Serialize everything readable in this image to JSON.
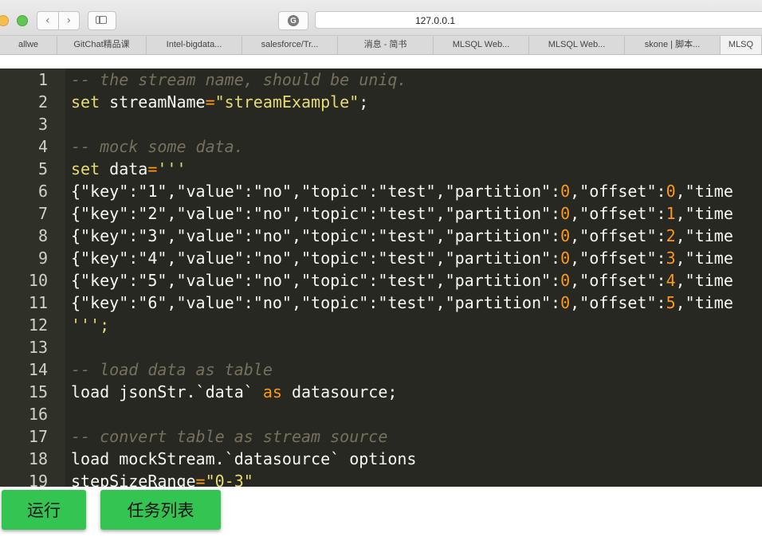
{
  "browser": {
    "url": "127.0.0.1",
    "reload_icon": "G",
    "back_icon": "‹",
    "forward_icon": "›",
    "tabs": [
      {
        "label": "allwe",
        "width": 72
      },
      {
        "label": "GitChat精品课",
        "width": 112
      },
      {
        "label": "Intel-bigdata...",
        "width": 120
      },
      {
        "label": "salesforce/Tr...",
        "width": 120
      },
      {
        "label": "消息 - 简书",
        "width": 120
      },
      {
        "label": "MLSQL Web...",
        "width": 120
      },
      {
        "label": "MLSQL Web...",
        "width": 120
      },
      {
        "label": "skone | 脚本...",
        "width": 120
      },
      {
        "label": "MLSQ",
        "width": 52
      }
    ]
  },
  "editor": {
    "line_numbers": [
      "1",
      "2",
      "3",
      "4",
      "5",
      "6",
      "7",
      "8",
      "9",
      "10",
      "11",
      "12",
      "13",
      "14",
      "15",
      "16",
      "17",
      "18",
      "19"
    ],
    "lines": [
      [
        {
          "t": "-- the stream name, should be uniq.",
          "c": "cm"
        }
      ],
      [
        {
          "t": "set ",
          "c": "kw"
        },
        {
          "t": "streamName",
          "c": ""
        },
        {
          "t": "=",
          "c": "num"
        },
        {
          "t": "\"streamExample\"",
          "c": "str"
        },
        {
          "t": ";",
          "c": ""
        }
      ],
      [],
      [
        {
          "t": "-- mock some data.",
          "c": "cm"
        }
      ],
      [
        {
          "t": "set ",
          "c": "kw"
        },
        {
          "t": "data",
          "c": ""
        },
        {
          "t": "=",
          "c": "num"
        },
        {
          "t": "'''",
          "c": "str"
        }
      ],
      [
        {
          "t": "{\"key\":\"1\",\"value\":\"no\",\"topic\":\"test\",\"partition\":",
          "c": ""
        },
        {
          "t": "0",
          "c": "num"
        },
        {
          "t": ",\"offset\":",
          "c": ""
        },
        {
          "t": "0",
          "c": "num"
        },
        {
          "t": ",\"time",
          "c": ""
        }
      ],
      [
        {
          "t": "{\"key\":\"2\",\"value\":\"no\",\"topic\":\"test\",\"partition\":",
          "c": ""
        },
        {
          "t": "0",
          "c": "num"
        },
        {
          "t": ",\"offset\":",
          "c": ""
        },
        {
          "t": "1",
          "c": "num"
        },
        {
          "t": ",\"time",
          "c": ""
        }
      ],
      [
        {
          "t": "{\"key\":\"3\",\"value\":\"no\",\"topic\":\"test\",\"partition\":",
          "c": ""
        },
        {
          "t": "0",
          "c": "num"
        },
        {
          "t": ",\"offset\":",
          "c": ""
        },
        {
          "t": "2",
          "c": "num"
        },
        {
          "t": ",\"time",
          "c": ""
        }
      ],
      [
        {
          "t": "{\"key\":\"4\",\"value\":\"no\",\"topic\":\"test\",\"partition\":",
          "c": ""
        },
        {
          "t": "0",
          "c": "num"
        },
        {
          "t": ",\"offset\":",
          "c": ""
        },
        {
          "t": "3",
          "c": "num"
        },
        {
          "t": ",\"time",
          "c": ""
        }
      ],
      [
        {
          "t": "{\"key\":\"5\",\"value\":\"no\",\"topic\":\"test\",\"partition\":",
          "c": ""
        },
        {
          "t": "0",
          "c": "num"
        },
        {
          "t": ",\"offset\":",
          "c": ""
        },
        {
          "t": "4",
          "c": "num"
        },
        {
          "t": ",\"time",
          "c": ""
        }
      ],
      [
        {
          "t": "{\"key\":\"6\",\"value\":\"no\",\"topic\":\"test\",\"partition\":",
          "c": ""
        },
        {
          "t": "0",
          "c": "num"
        },
        {
          "t": ",\"offset\":",
          "c": ""
        },
        {
          "t": "5",
          "c": "num"
        },
        {
          "t": ",\"time",
          "c": ""
        }
      ],
      [
        {
          "t": "''';",
          "c": "str"
        }
      ],
      [],
      [
        {
          "t": "-- load data as table",
          "c": "cm"
        }
      ],
      [
        {
          "t": "load jsonStr.`data` ",
          "c": ""
        },
        {
          "t": "as",
          "c": "num"
        },
        {
          "t": " datasource;",
          "c": ""
        }
      ],
      [],
      [
        {
          "t": "-- convert table as stream source",
          "c": "cm"
        }
      ],
      [
        {
          "t": "load mockStream.`datasource` options",
          "c": ""
        }
      ],
      [
        {
          "t": "stepSizeRange",
          "c": ""
        },
        {
          "t": "=",
          "c": "num"
        },
        {
          "t": "\"0-3\"",
          "c": "str"
        }
      ]
    ]
  },
  "buttons": {
    "run": "运行",
    "task_list": "任务列表"
  },
  "colors": {
    "editor_bg": "#272822",
    "gutter_bg": "#2f3129",
    "button_green": "#34c452"
  }
}
